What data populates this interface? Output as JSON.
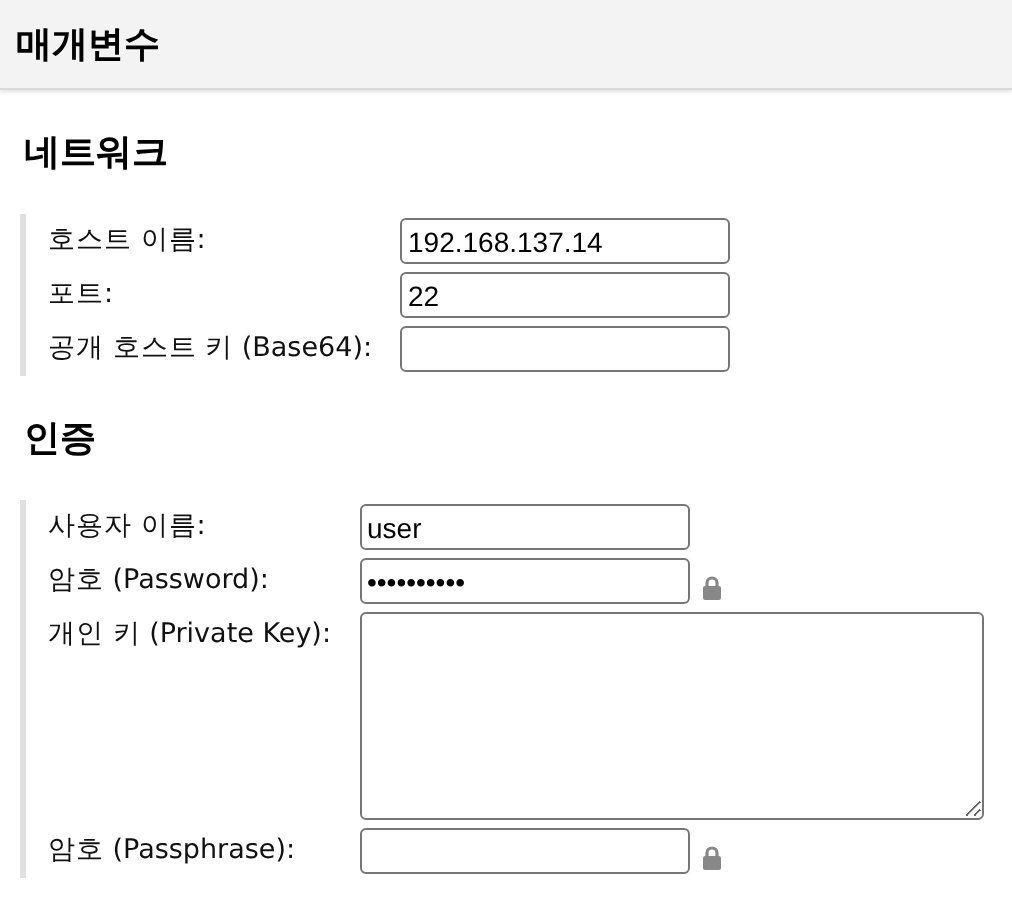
{
  "header": {
    "title": "매개변수"
  },
  "sections": [
    {
      "title": "네트워크",
      "fields": [
        {
          "label": "호스트 이름:",
          "kind": "text",
          "value": "192.168.137.14"
        },
        {
          "label": "포트:",
          "kind": "text",
          "value": "22"
        },
        {
          "label": "공개 호스트 키 (Base64):",
          "kind": "text"
        }
      ]
    },
    {
      "title": "인증",
      "fields": [
        {
          "label": "사용자 이름:",
          "kind": "text",
          "value": "user"
        },
        {
          "label": "암호 (Password):",
          "kind": "password",
          "value": "••••••••••"
        },
        {
          "label": "개인 키 (Private Key):",
          "kind": "textarea"
        },
        {
          "label": "암호 (Passphrase):",
          "kind": "password"
        }
      ]
    }
  ]
}
